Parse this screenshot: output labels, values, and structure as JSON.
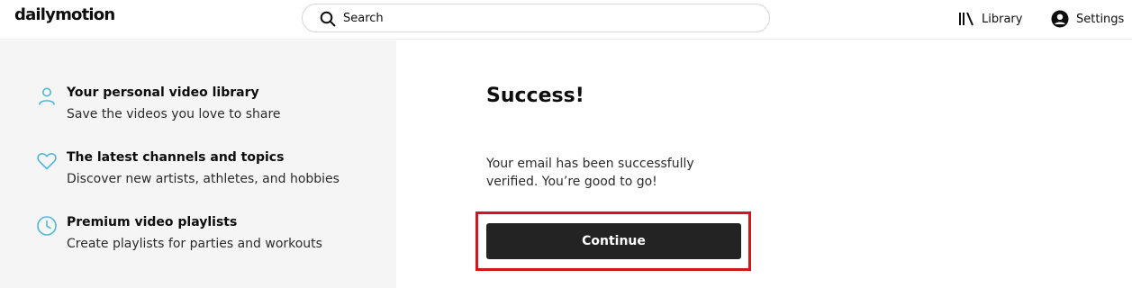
{
  "header": {
    "logo": "dailymotion",
    "search_placeholder": "Search",
    "library_label": "Library",
    "settings_label": "Settings"
  },
  "features": [
    {
      "icon": "person-icon",
      "title": "Your personal video library",
      "description": "Save the videos you love to share"
    },
    {
      "icon": "heart-icon",
      "title": "The latest channels and topics",
      "description": "Discover new artists, athletes, and hobbies"
    },
    {
      "icon": "clock-icon",
      "title": "Premium video playlists",
      "description": "Create playlists for parties and workouts"
    }
  ],
  "main": {
    "title": "Success!",
    "message": "Your email has been successfully verified. You’re good to go!",
    "continue_label": "Continue"
  },
  "colors": {
    "accent_icon": "#4fb8d9",
    "button_bg": "#232323",
    "highlight": "#d0161e",
    "panel_bg": "#f5f5f5"
  }
}
